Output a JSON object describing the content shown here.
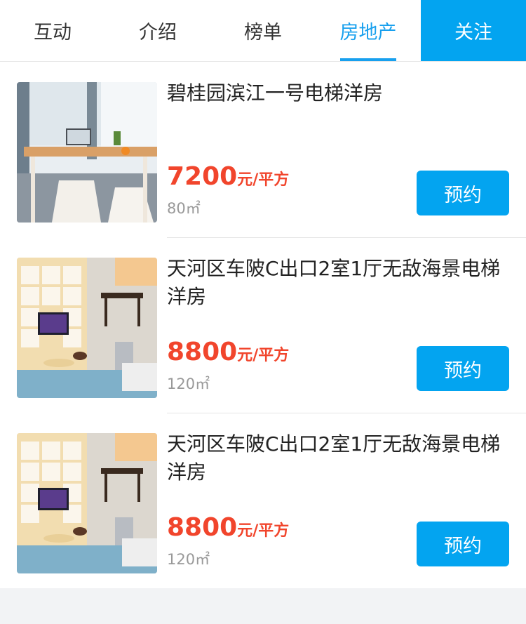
{
  "tabs": [
    {
      "label": "互动"
    },
    {
      "label": "介绍"
    },
    {
      "label": "榜单"
    },
    {
      "label": "房地产"
    }
  ],
  "follow_label": "关注",
  "listings": [
    {
      "title": "碧桂园滨江一号电梯洋房",
      "price": "7200",
      "unit": "元/平方",
      "area": "80㎡",
      "button": "预约"
    },
    {
      "title": "天河区车陂C出口2室1厅无敌海景电梯洋房",
      "price": "8800",
      "unit": "元/平方",
      "area": "120㎡",
      "button": "预约"
    },
    {
      "title": "天河区车陂C出口2室1厅无敌海景电梯洋房",
      "price": "8800",
      "unit": "元/平方",
      "area": "120㎡",
      "button": "预约"
    }
  ],
  "colors": {
    "accent": "#03a4f0",
    "price": "#f1452c",
    "active_tab": "#18a0ee"
  }
}
